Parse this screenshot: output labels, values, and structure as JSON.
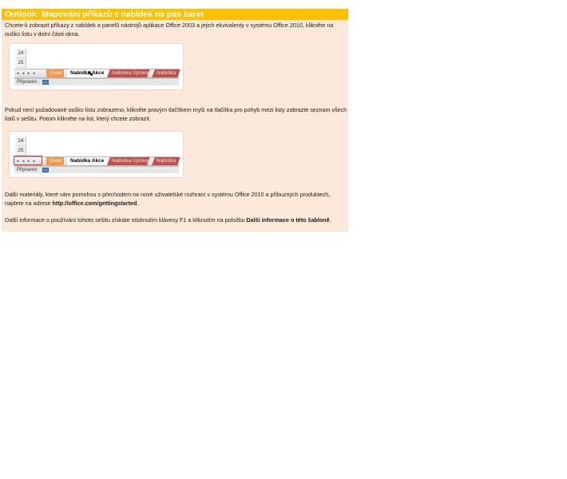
{
  "page": {
    "title": "Outlook: Mapování příkazů z nabídek na pás karet",
    "para1": "Chcete-li zobrazit příkazy z nabídek a panelů nástrojů aplikace Office 2003 a jejich ekvivalenty v systému Office 2010, klikněte na ouško listu v dolní části okna.",
    "para2": "Pokud není požadované ouško listu zobrazeno, klikněte pravým tlačítkem myši na tlačítka pro pohyb mezi listy zobrazte seznam všech listů v sešitu. Potom klikněte na list, který chcete zobrazit.",
    "para3_pre": "Další materiály, které vám pomohou s přechodem na nové uživatelské rozhraní v systému Office 2010 a příbuzných produktech, najdete na adrese ",
    "para3_link": "http://office.com/gettingstarted",
    "para3_post": ".",
    "para4_pre": "Další informace o používání tohoto sešitu získáte stisknutím klávesy F1 a kliknutím na položku ",
    "para4_bold": "Další informace o této šabloně",
    "para4_post": "."
  },
  "screenshot1": {
    "rows": [
      "24",
      "25"
    ],
    "tabs": {
      "uvod": "Úvod",
      "akce": "Nabídka Akce",
      "upravy": "Nabídka Úpravy",
      "next": "Nabídka"
    },
    "status": "Připraven"
  },
  "screenshot2": {
    "rows": [
      "24",
      "25"
    ],
    "tabs": {
      "uvod": "Úvod",
      "akce": "Nabídka Akce",
      "upravy": "Nabídka Úpravy",
      "next": "Nabídka"
    },
    "status": "Připraven"
  },
  "nav_glyphs": [
    "◂",
    "◂",
    "▸",
    "▸"
  ],
  "colors": {
    "title_bar": "#ffc000",
    "panel_bg": "#fde9d9",
    "tab_orange": "#f79646",
    "tab_red": "#c0504d",
    "highlight": "#c0392b"
  }
}
